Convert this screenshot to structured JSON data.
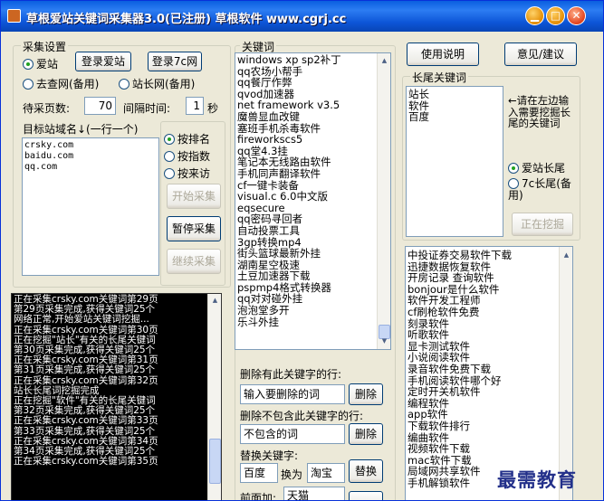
{
  "title": {
    "text": "草根爱站关键词采集器3.0(已注册)   草根软件 www.cgrj.cc",
    "min": "▁",
    "max": "□",
    "close": "✕"
  },
  "colors": {
    "titlebar": "#0a5fe0",
    "window_bg": "#ece9d8",
    "log_bg": "#000000",
    "watermark": "#23308a"
  },
  "settings": {
    "group_label": "采集设置",
    "radio_aizhan": "爱站",
    "login_aizhan": "登录爱站",
    "login_7c": "登录7c网",
    "radio_qucha": "去查网(备用)",
    "radio_zhanchang": "站长网(备用)",
    "pages_label": "待采页数:",
    "pages_value": "70",
    "interval_label": "间隔时间:",
    "interval_value": "1",
    "interval_unit": "秒",
    "target_label": "目标站域名↓(一行一个)",
    "domains": [
      "crsky.com",
      "baidu.com",
      "qq.com"
    ],
    "sort_rank": "按排名",
    "sort_index": "按指数",
    "sort_visit": "按来访",
    "start_btn": "开始采集",
    "pause_btn": "暂停采集",
    "continue_btn": "继续采集"
  },
  "log": [
    "正在采集crsky.com关键词第29页",
    "第29页采集完成,获得关键词25个",
    "网络正常,开始爱站关键词挖掘...",
    "正在采集crsky.com关键词第30页",
    "正在挖掘\"站长\"有关的长尾关键词",
    "第30页采集完成,获得关键词25个",
    "正在采集crsky.com关键词第31页",
    "第31页采集完成,获得关键词25个",
    "正在采集crsky.com关键词第32页",
    "站长长尾词挖掘完成",
    "正在挖掘\"软件\"有关的长尾关键词",
    "第32页采集完成,获得关键词25个",
    "正在采集crsky.com关键词第33页",
    "第33页采集完成,获得关键词25个",
    "正在采集crsky.com关键词第34页",
    "第34页采集完成,获得关键词25个",
    "正在采集crsky.com关键词第35页"
  ],
  "keywords": {
    "group_label": "关键词",
    "items": [
      "windows xp sp2补丁",
      "qq农场小帮手",
      "qq餐厅作弊",
      "qvod加速器",
      "net framework v3.5",
      "魔兽显血改键",
      "塞班手机杀毒软件",
      "fireworkscs5",
      "qq堂4.3挂",
      "笔记本无线路由软件",
      "手机同声翻译软件",
      "cf一键卡装备",
      "visual.c 6.0中文版",
      "eqsecure",
      "qq密码寻回者",
      "自动投票工具",
      "3gp转换mp4",
      "街头篮球最新外挂",
      "湖南星空极速",
      "土豆加速器下载",
      "pspmp4格式转换器",
      "qq对对碰外挂",
      "泡泡堂多开",
      "乐斗外挂"
    ],
    "del_has_label": "删除有此关键字的行:",
    "del_has_placeholder": "输入要删除的词",
    "del_btn": "删除",
    "del_not_label": "删除不包含此关键字的行:",
    "del_not_placeholder": "不包含的词",
    "del_btn2": "删除",
    "replace_label": "替换关键字:",
    "replace_from": "百度",
    "replace_as": "换为",
    "replace_to": "淘宝",
    "replace_btn": "替换",
    "prefix_label": "前面加:",
    "prefix_value": "天猫"
  },
  "right": {
    "help_btn": "使用说明",
    "feedback_btn": "意见/建议",
    "longtail_label": "长尾关键词",
    "seeds": [
      "站长",
      "软件",
      "百度"
    ],
    "hint": "←请在左边输入需要挖掘长尾的关键词",
    "radio_aizhan_tail": "爱站长尾",
    "radio_7c_tail": "7c长尾(备用)",
    "mining_btn": "正在挖掘",
    "results": [
      "中投证券交易软件下载",
      "迅捷数据恢复软件",
      "开房记录 查询软件",
      "bonjour是什么软件",
      "软件开发工程师",
      "cf刷枪软件免费",
      "刻录软件",
      "听歌软件",
      "显卡测试软件",
      "小说阅读软件",
      "录音软件免费下载",
      "手机阅读软件哪个好",
      "定时开关机软件",
      "编程软件",
      "app软件",
      "下载软件排行",
      "编曲软件",
      "视频软件下载",
      "mac软件下载",
      "局域网共享软件",
      "手机解锁软件"
    ]
  },
  "watermark": "最需教育"
}
